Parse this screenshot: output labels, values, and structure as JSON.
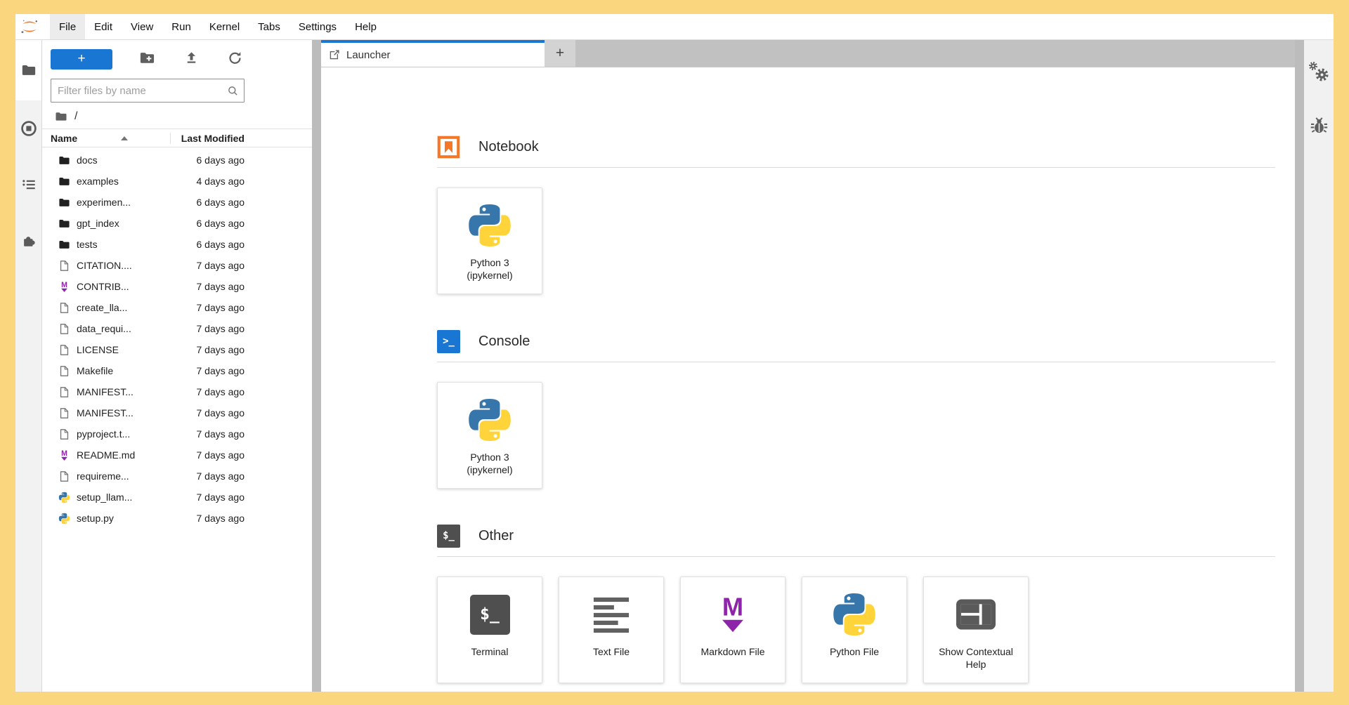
{
  "window": {
    "menu": {
      "items": [
        "File",
        "Edit",
        "View",
        "Run",
        "Kernel",
        "Tabs",
        "Settings",
        "Help"
      ],
      "active_item": "File"
    },
    "left_sidebar_icons": [
      "folder-icon",
      "running-sessions-icon",
      "table-of-contents-icon",
      "extensions-puzzle-icon"
    ],
    "right_sidebar_icons": [
      "property-inspector-gears-icon",
      "debugger-bug-icon"
    ]
  },
  "file_browser": {
    "toolbar": {
      "new_launcher_label": "+",
      "icons": [
        "new-folder-icon",
        "upload-icon",
        "refresh-icon"
      ]
    },
    "filter_placeholder": "Filter files by name",
    "breadcrumb": "/",
    "header": {
      "name": "Name",
      "modified": "Last Modified",
      "sort_direction": "ascending"
    },
    "files": [
      {
        "name": "docs",
        "icon": "folder",
        "modified": "6 days ago"
      },
      {
        "name": "examples",
        "icon": "folder",
        "modified": "4 days ago"
      },
      {
        "name": "experimen...",
        "icon": "folder",
        "modified": "6 days ago"
      },
      {
        "name": "gpt_index",
        "icon": "folder",
        "modified": "6 days ago"
      },
      {
        "name": "tests",
        "icon": "folder",
        "modified": "6 days ago"
      },
      {
        "name": "CITATION....",
        "icon": "file",
        "modified": "7 days ago"
      },
      {
        "name": "CONTRIB...",
        "icon": "markdown",
        "modified": "7 days ago"
      },
      {
        "name": "create_lla...",
        "icon": "file",
        "modified": "7 days ago"
      },
      {
        "name": "data_requi...",
        "icon": "file",
        "modified": "7 days ago"
      },
      {
        "name": "LICENSE",
        "icon": "file",
        "modified": "7 days ago"
      },
      {
        "name": "Makefile",
        "icon": "file",
        "modified": "7 days ago"
      },
      {
        "name": "MANIFEST...",
        "icon": "file",
        "modified": "7 days ago"
      },
      {
        "name": "MANIFEST...",
        "icon": "file",
        "modified": "7 days ago"
      },
      {
        "name": "pyproject.t...",
        "icon": "file",
        "modified": "7 days ago"
      },
      {
        "name": "README.md",
        "icon": "markdown",
        "modified": "7 days ago"
      },
      {
        "name": "requireme...",
        "icon": "file",
        "modified": "7 days ago"
      },
      {
        "name": "setup_llam...",
        "icon": "python",
        "modified": "7 days ago"
      },
      {
        "name": "setup.py",
        "icon": "python",
        "modified": "7 days ago"
      }
    ]
  },
  "main": {
    "tab": {
      "label": "Launcher",
      "icon": "launcher-icon"
    },
    "new_tab_label": "+",
    "launcher": {
      "sections": [
        {
          "title": "Notebook",
          "icon": "notebook",
          "cards": [
            {
              "label": "Python 3\n(ipykernel)",
              "icon": "python"
            }
          ]
        },
        {
          "title": "Console",
          "icon": "console",
          "cards": [
            {
              "label": "Python 3\n(ipykernel)",
              "icon": "python"
            }
          ]
        },
        {
          "title": "Other",
          "icon": "terminal-dark",
          "cards": [
            {
              "label": "Terminal",
              "icon": "terminal"
            },
            {
              "label": "Text File",
              "icon": "text-file"
            },
            {
              "label": "Markdown File",
              "icon": "markdown"
            },
            {
              "label": "Python File",
              "icon": "python"
            },
            {
              "label": "Show Contextual Help",
              "icon": "layout"
            }
          ]
        }
      ]
    }
  },
  "colors": {
    "frame": "#FAD77E",
    "accent_blue": "#1976d2",
    "jupyter_orange": "#F37726",
    "markdown_purple": "#8E24AA",
    "python_blue": "#3776AB",
    "python_yellow": "#FFD43B"
  }
}
